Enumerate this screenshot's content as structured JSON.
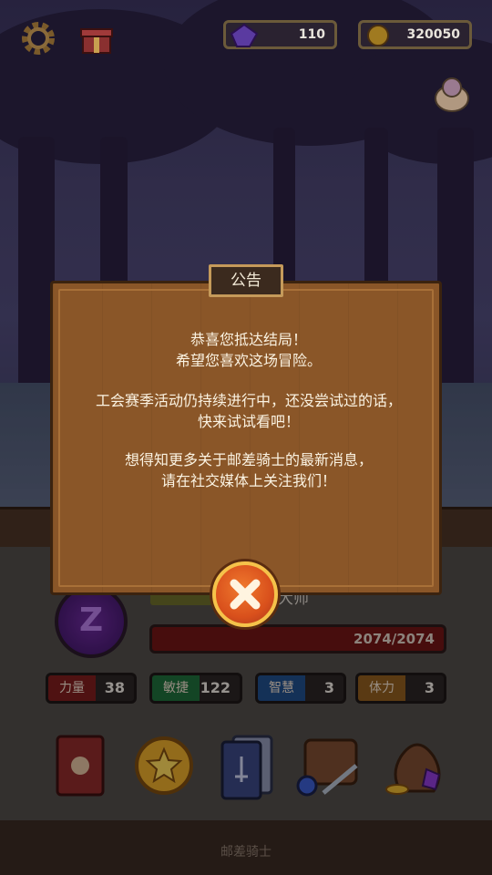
{
  "resources": {
    "gems": "110",
    "coins": "320050"
  },
  "notice": {
    "title": "公告",
    "line1": "恭喜您抵达结局！",
    "line2": "希望您喜欢这场冒险。",
    "line3": "工会赛季活动仍持续进行中，还没尝试过的话，",
    "line4": "快来试试看吧！",
    "line5": "想得知更多关于邮差骑士的最新消息，",
    "line6": "请在社交媒体上关注我们！"
  },
  "character": {
    "name_partial": "大师",
    "hp": "2074/2074"
  },
  "stats": [
    {
      "label": "力量",
      "value": "38",
      "color": "#7a1c1c"
    },
    {
      "label": "敏捷",
      "value": "122",
      "color": "#1e6a3a"
    },
    {
      "label": "智慧",
      "value": "3",
      "color": "#1f4c86"
    },
    {
      "label": "体力",
      "value": "3",
      "color": "#8a5a1e"
    }
  ],
  "footer": {
    "title": "邮差骑士"
  },
  "icons": {
    "settings": "gear-icon",
    "gift": "gift-icon",
    "gem": "gem-icon",
    "coin": "coin-icon",
    "pet": "pet-icon",
    "close": "close-icon"
  }
}
